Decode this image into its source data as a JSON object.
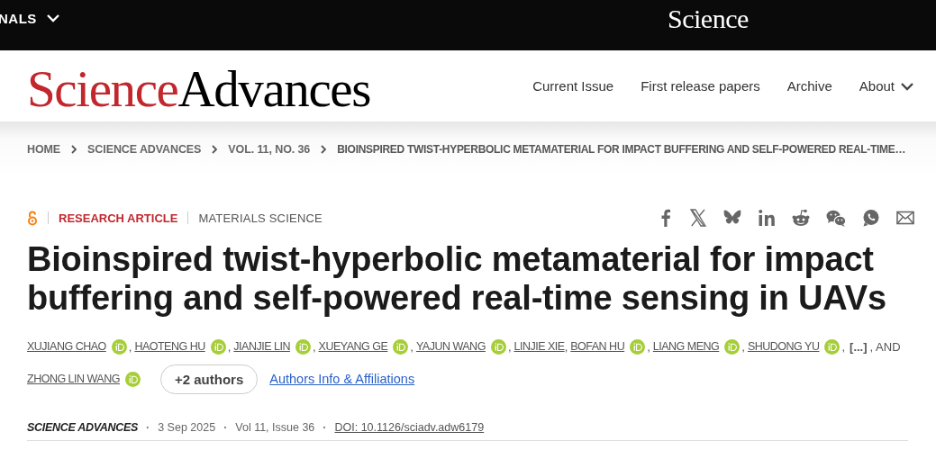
{
  "top_bar": {
    "menu": "NALS",
    "brand": "Science"
  },
  "header": {
    "logo": [
      "Science",
      "Advances"
    ],
    "nav": [
      {
        "label": "Current Issue",
        "dropdown": false
      },
      {
        "label": "First release papers",
        "dropdown": false
      },
      {
        "label": "Archive",
        "dropdown": false
      },
      {
        "label": "About",
        "dropdown": true
      }
    ]
  },
  "breadcrumb": [
    "HOME",
    "SCIENCE ADVANCES",
    "VOL. 11, NO. 36",
    "BIOINSPIRED TWIST-HYPERBOLIC METAMATERIAL FOR IMPACT BUFFERING AND SELF-POWERED REAL-TIME…"
  ],
  "article": {
    "open_access": true,
    "type": "RESEARCH ARTICLE",
    "subject": "MATERIALS SCIENCE",
    "share": [
      {
        "kind": "facebook"
      },
      {
        "kind": "x"
      },
      {
        "kind": "bluesky"
      },
      {
        "kind": "linkedin"
      },
      {
        "kind": "reddit"
      },
      {
        "kind": "wechat"
      },
      {
        "kind": "whatsapp"
      },
      {
        "kind": "email"
      }
    ],
    "title": "Bioinspired twist-hyperbolic metamaterial for impact buffering and self-powered real-time sensing in UAVs",
    "authors": [
      {
        "name": "XUJIANG CHAO",
        "orcid": true,
        "separator": ","
      },
      {
        "name": "HAOTENG HU",
        "orcid": true,
        "separator": ","
      },
      {
        "name": "JIANJIE LIN",
        "orcid": true,
        "separator": ","
      },
      {
        "name": "XUEYANG GE",
        "orcid": true,
        "separator": ","
      },
      {
        "name": "YAJUN WANG",
        "orcid": true,
        "separator": ","
      },
      {
        "name": "LINJIE XIE",
        "orcid": false,
        "separator": ","
      },
      {
        "name": "BOFAN HU",
        "orcid": true,
        "separator": ","
      },
      {
        "name": "LIANG MENG",
        "orcid": true,
        "separator": ","
      },
      {
        "name": "SHUDONG YU",
        "orcid": true,
        "separator": ","
      }
    ],
    "ellipsis": "[...]",
    "and": ", AND",
    "last_author": {
      "name": "ZHONG LIN WANG",
      "orcid": true
    },
    "more_authors": "+2 authors",
    "affiliations_link": "Authors Info & Affiliations",
    "meta": [
      {
        "kind": "journal",
        "text": "SCIENCE ADVANCES"
      },
      {
        "kind": "separator",
        "text": "·"
      },
      {
        "kind": "date",
        "text": "3 Sep 2025"
      },
      {
        "kind": "separator",
        "text": "·"
      },
      {
        "kind": "issue",
        "text": "Vol 11, Issue 36"
      },
      {
        "kind": "separator",
        "text": "·"
      },
      {
        "kind": "doi",
        "text": "DOI: 10.1126/sciadv.adw6179"
      }
    ]
  }
}
